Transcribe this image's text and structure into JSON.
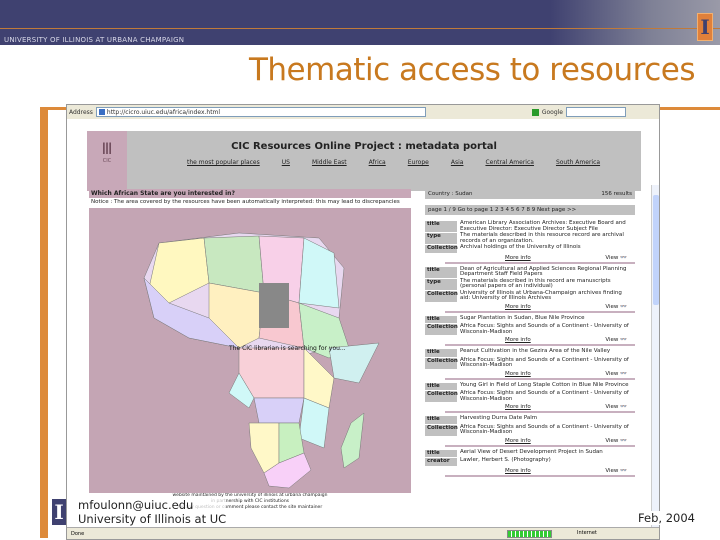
{
  "banner": {
    "university": "UNIVERSITY OF ILLINOIS AT URBANA CHAMPAIGN",
    "logo": "I"
  },
  "slide": {
    "title": "Thematic access to resources",
    "author_email": "mfoulonn@uiuc.edu",
    "author_org": "University of Illinois at UC",
    "date": "Feb, 2004"
  },
  "browser": {
    "address_label": "Address",
    "address": "http://cicro.uiuc.edu/africa/index.html",
    "search_label": "Google",
    "status": "Done",
    "zone": "Internet"
  },
  "portal": {
    "logo_text": "CIC",
    "title": "CIC Resources Online Project : metadata portal",
    "nav": [
      "the most popular places",
      "US",
      "Middle East",
      "Africa",
      "Europe",
      "Asia",
      "Central America",
      "South America"
    ],
    "question": "Which African State are you interested in?",
    "notice": "Notice : The area covered by the resources have been automatically interpreted: this may lead to discrepancies",
    "librarian": "The CIC librarian is searching for you...",
    "footer": [
      "website maintained by the university of illinois at urbana champaign",
      "in partnership with CIC institutions",
      "for any question or comment please contact the site maintainer"
    ]
  },
  "results": {
    "country": "Country : Sudan",
    "count": "156 results",
    "pager": "page 1 / 9    Go to page 1 2 3 4 5 6 7 8 9  Next page >>",
    "more_label": "More info",
    "view_label": "View",
    "records": [
      {
        "fields": [
          [
            "title",
            "American Library Association Archives: Executive Board and Executive Director: Executive Director Subject File"
          ],
          [
            "type",
            "The materials described in this resource record are archival records of an organization."
          ],
          [
            "Collection",
            "Archival holdings of the University of Illinois"
          ]
        ]
      },
      {
        "fields": [
          [
            "title",
            "Dean of Agricultural and Applied Sciences Regional Planning Department Staff Field Papers"
          ],
          [
            "type",
            "The materials described in this record are manuscripts (personal papers of an individual)"
          ],
          [
            "Collection",
            "University of Illinois at Urbana-Champaign archives finding aid: University of Illinois Archives"
          ]
        ]
      },
      {
        "fields": [
          [
            "title",
            "Sugar Plantation in Sudan, Blue Nile Province"
          ],
          [
            "Collection",
            "Africa Focus: Sights and Sounds of a Continent - University of Wisconsin-Madison"
          ]
        ]
      },
      {
        "fields": [
          [
            "title",
            "Peanut Cultivation in the Gezira Area of the Nile Valley"
          ],
          [
            "Collection",
            "Africa Focus: Sights and Sounds of a Continent - University of Wisconsin-Madison"
          ]
        ]
      },
      {
        "fields": [
          [
            "title",
            "Young Girl in Field of Long Staple Cotton in Blue Nile Province"
          ],
          [
            "Collection",
            "Africa Focus: Sights and Sounds of a Continent - University of Wisconsin-Madison"
          ]
        ]
      },
      {
        "fields": [
          [
            "title",
            "Harvesting Durra Date Palm"
          ],
          [
            "Collection",
            "Africa Focus: Sights and Sounds of a Continent - University of Wisconsin-Madison"
          ]
        ]
      },
      {
        "fields": [
          [
            "title",
            "Aerial View of Desert Development Project in Sudan"
          ],
          [
            "creator",
            "Lawler, Herbert S. (Photography)"
          ]
        ]
      }
    ]
  },
  "colors": {
    "banner": "#3f4170",
    "accent": "#c8791f",
    "map_bg": "#c4a5b4"
  }
}
